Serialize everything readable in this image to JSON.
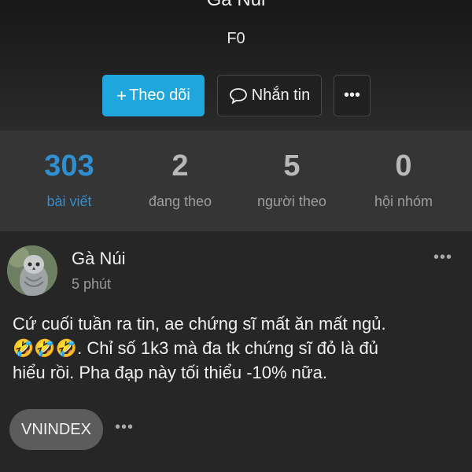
{
  "profile": {
    "name": "Gà Núi",
    "subtitle": "F0",
    "follow_label": "Theo dõi",
    "follow_plus": "+",
    "message_label": "Nhắn tin",
    "more_label": "•••"
  },
  "stats": [
    {
      "value": "303",
      "label": "bài viết",
      "active": true
    },
    {
      "value": "2",
      "label": "đang theo",
      "active": false
    },
    {
      "value": "5",
      "label": "người theo",
      "active": false
    },
    {
      "value": "0",
      "label": "hội nhóm",
      "active": false
    }
  ],
  "post": {
    "author": "Gà Núi",
    "time": "5 phút",
    "more_label": "•••",
    "content": "Cứ cuối tuần ra tin, ae chứng sĩ mất ăn mất ngủ.\n🤣🤣🤣. Chỉ số 1k3 mà đa tk chứng sĩ đỏ là đủ\nhiểu rồi. Pha đạp này tối thiểu -10% nữa.",
    "tag": "VNINDEX",
    "tag_more_label": "•••"
  },
  "colors": {
    "accent": "#1fa6dc",
    "stat_active": "#2f8fd0",
    "background": "#242424"
  }
}
